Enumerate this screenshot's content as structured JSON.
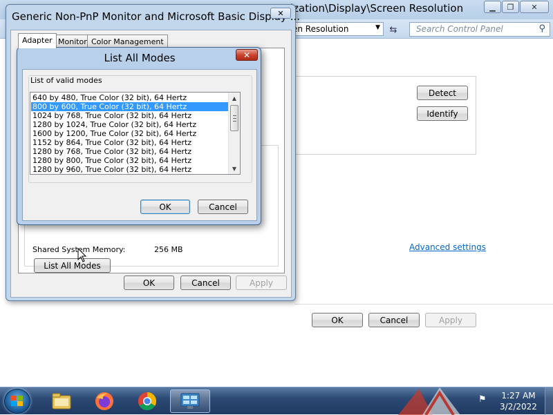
{
  "background_window": {
    "title": "Control Panel\\Appearance and Personalization\\Display\\Screen Resolution",
    "title_visible": "ization\\Display\\Screen Resolution",
    "address_visible": "en Resolution",
    "search_placeholder": "Search Control Panel",
    "detect_label": "Detect",
    "identify_label": "Identify",
    "advanced_settings_label": "Advanced settings",
    "ok_label": "OK",
    "cancel_label": "Cancel",
    "apply_label": "Apply"
  },
  "adapter_dialog": {
    "title": "Generic Non-PnP Monitor and Microsoft Basic Display ...",
    "tabs": [
      {
        "label": "Adapter",
        "active": true
      },
      {
        "label": "Monitor",
        "active": false
      },
      {
        "label": "Color Management",
        "active": false
      }
    ],
    "shared_memory_label": "Shared System Memory:",
    "shared_memory_value": "256 MB",
    "list_all_modes_label": "List All Modes",
    "ok_label": "OK",
    "cancel_label": "Cancel",
    "apply_label": "Apply"
  },
  "modes_dialog": {
    "title": "List All Modes",
    "group_label": "List of valid modes",
    "modes": [
      "640 by 480, True Color (32 bit), 64 Hertz",
      "800 by 600, True Color (32 bit), 64 Hertz",
      "1024 by 768, True Color (32 bit), 64 Hertz",
      "1280 by 1024, True Color (32 bit), 64 Hertz",
      "1600 by 1200, True Color (32 bit), 64 Hertz",
      "1152 by 864, True Color (32 bit), 64 Hertz",
      "1280 by 768, True Color (32 bit), 64 Hertz",
      "1280 by 800, True Color (32 bit), 64 Hertz",
      "1280 by 960, True Color (32 bit), 64 Hertz"
    ],
    "selected_index": 1,
    "ok_label": "OK",
    "cancel_label": "Cancel"
  },
  "taskbar": {
    "time": "1:27 AM",
    "date": "3/2/2022",
    "apps": [
      "start-orb",
      "file-explorer-icon",
      "firefox-icon",
      "chrome-icon",
      "display-settings-icon"
    ]
  },
  "colors": {
    "selection": "#3399ff",
    "link": "#0066cc",
    "close_red": "#c7402b",
    "taskbar": "#1f3a62"
  }
}
